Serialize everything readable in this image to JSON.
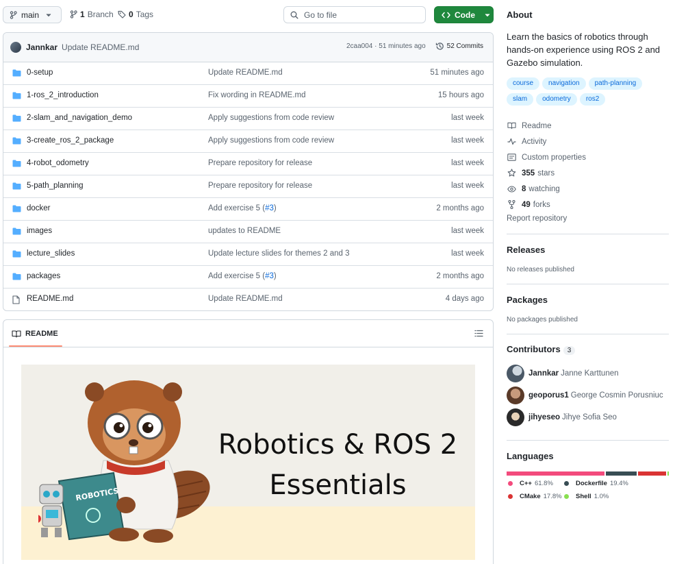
{
  "topbar": {
    "branch": "main",
    "branch_count": "1",
    "branch_label": "Branch",
    "tag_count": "0",
    "tag_label": "Tags",
    "goto_placeholder": "Go to file",
    "code_label": "Code"
  },
  "latest_commit": {
    "author": "Jannkar",
    "message": "Update README.md",
    "hash_time": "2caa004 · 51 minutes ago",
    "commits_label": "52 Commits"
  },
  "files": [
    {
      "type": "folder",
      "name": "0-setup",
      "message": "Update README.md",
      "time": "51 minutes ago"
    },
    {
      "type": "folder",
      "name": "1-ros_2_introduction",
      "message": "Fix wording in README.md",
      "time": "15 hours ago"
    },
    {
      "type": "folder",
      "name": "2-slam_and_navigation_demo",
      "message": "Apply suggestions from code review",
      "time": "last week"
    },
    {
      "type": "folder",
      "name": "3-create_ros_2_package",
      "message": "Apply suggestions from code review",
      "time": "last week"
    },
    {
      "type": "folder",
      "name": "4-robot_odometry",
      "message": "Prepare repository for release",
      "time": "last week"
    },
    {
      "type": "folder",
      "name": "5-path_planning",
      "message": "Prepare repository for release",
      "time": "last week"
    },
    {
      "type": "folder",
      "name": "docker",
      "message": "Add exercise 5 (",
      "link": "#3",
      "message_end": ")",
      "time": "2 months ago"
    },
    {
      "type": "folder",
      "name": "images",
      "message": "updates to README",
      "time": "last week"
    },
    {
      "type": "folder",
      "name": "lecture_slides",
      "message": "Update lecture slides for themes 2 and 3",
      "time": "last week"
    },
    {
      "type": "folder",
      "name": "packages",
      "message": "Add exercise 5 (",
      "link": "#3",
      "message_end": ")",
      "time": "2 months ago"
    },
    {
      "type": "file",
      "name": "README.md",
      "message": "Update README.md",
      "time": "4 days ago"
    }
  ],
  "readme": {
    "tab_label": "README",
    "banner_title_1": "Robotics & ROS 2",
    "banner_title_2": "Essentials",
    "book_text": "ROBOTICS"
  },
  "about": {
    "heading": "About",
    "description": "Learn the basics of robotics through hands-on experience using ROS 2 and Gazebo simulation.",
    "topics": [
      "course",
      "navigation",
      "path-planning",
      "slam",
      "odometry",
      "ros2"
    ],
    "links": [
      {
        "icon": "book-icon",
        "label": "Readme"
      },
      {
        "icon": "pulse-icon",
        "label": "Activity"
      },
      {
        "icon": "note-icon",
        "label": "Custom properties"
      },
      {
        "icon": "star-icon",
        "count": "355",
        "label": "stars"
      },
      {
        "icon": "eye-icon",
        "count": "8",
        "label": "watching"
      },
      {
        "icon": "fork-icon",
        "count": "49",
        "label": "forks"
      }
    ],
    "report": "Report repository"
  },
  "releases": {
    "heading": "Releases",
    "empty": "No releases published"
  },
  "packages": {
    "heading": "Packages",
    "empty": "No packages published"
  },
  "contributors": {
    "heading": "Contributors",
    "count": "3",
    "list": [
      {
        "login": "Jannkar",
        "name": "Janne Karttunen"
      },
      {
        "login": "geoporus1",
        "name": "George Cosmin Porusniuc"
      },
      {
        "login": "jihyeseo",
        "name": "Jihye Sofia Seo"
      }
    ]
  },
  "languages": {
    "heading": "Languages",
    "items": [
      {
        "name": "C++",
        "percent": "61.8%",
        "share": 61.8,
        "color": "#f34b7d"
      },
      {
        "name": "Dockerfile",
        "percent": "19.4%",
        "share": 19.4,
        "color": "#384d54"
      },
      {
        "name": "CMake",
        "percent": "17.8%",
        "share": 17.8,
        "color": "#da3434"
      },
      {
        "name": "Shell",
        "percent": "1.0%",
        "share": 1.0,
        "color": "#89e051"
      }
    ]
  }
}
